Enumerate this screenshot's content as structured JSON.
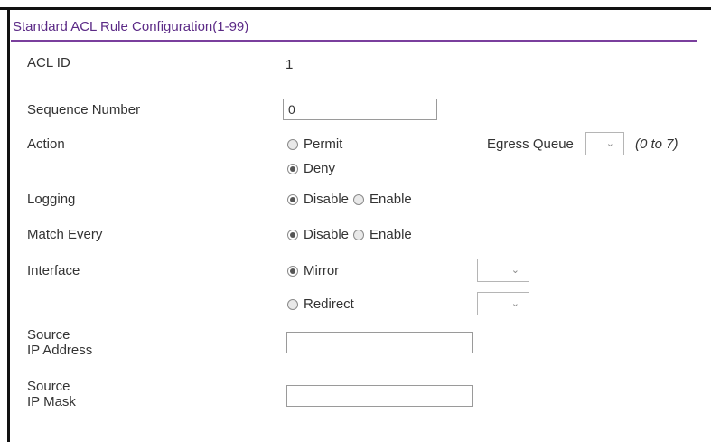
{
  "panel": {
    "title": "Standard ACL Rule Configuration(1-99)"
  },
  "acl_id": {
    "label": "ACL ID",
    "value": "1"
  },
  "sequence_number": {
    "label": "Sequence Number",
    "value": "0"
  },
  "action": {
    "label": "Action",
    "options": [
      "Permit",
      "Deny"
    ],
    "selected": "Deny",
    "egress_queue": {
      "label": "Egress Queue",
      "selected": "",
      "arrow": "⌄",
      "range_hint": "(0 to 7)"
    }
  },
  "logging": {
    "label": "Logging",
    "options": [
      "Disable",
      "Enable"
    ],
    "selected": "Disable"
  },
  "match_every": {
    "label": "Match Every",
    "options": [
      "Disable",
      "Enable"
    ],
    "selected": "Disable"
  },
  "interface": {
    "label": "Interface",
    "options": [
      "Mirror",
      "Redirect"
    ],
    "selected": "Mirror",
    "mirror_select": {
      "selected": "",
      "arrow": "⌄"
    },
    "redirect_select": {
      "selected": "",
      "arrow": "⌄"
    }
  },
  "source_ip_address": {
    "label_line1": "Source",
    "label_line2": "IP Address",
    "value": ""
  },
  "source_ip_mask": {
    "label_line1": "Source",
    "label_line2": "IP Mask",
    "value": ""
  }
}
